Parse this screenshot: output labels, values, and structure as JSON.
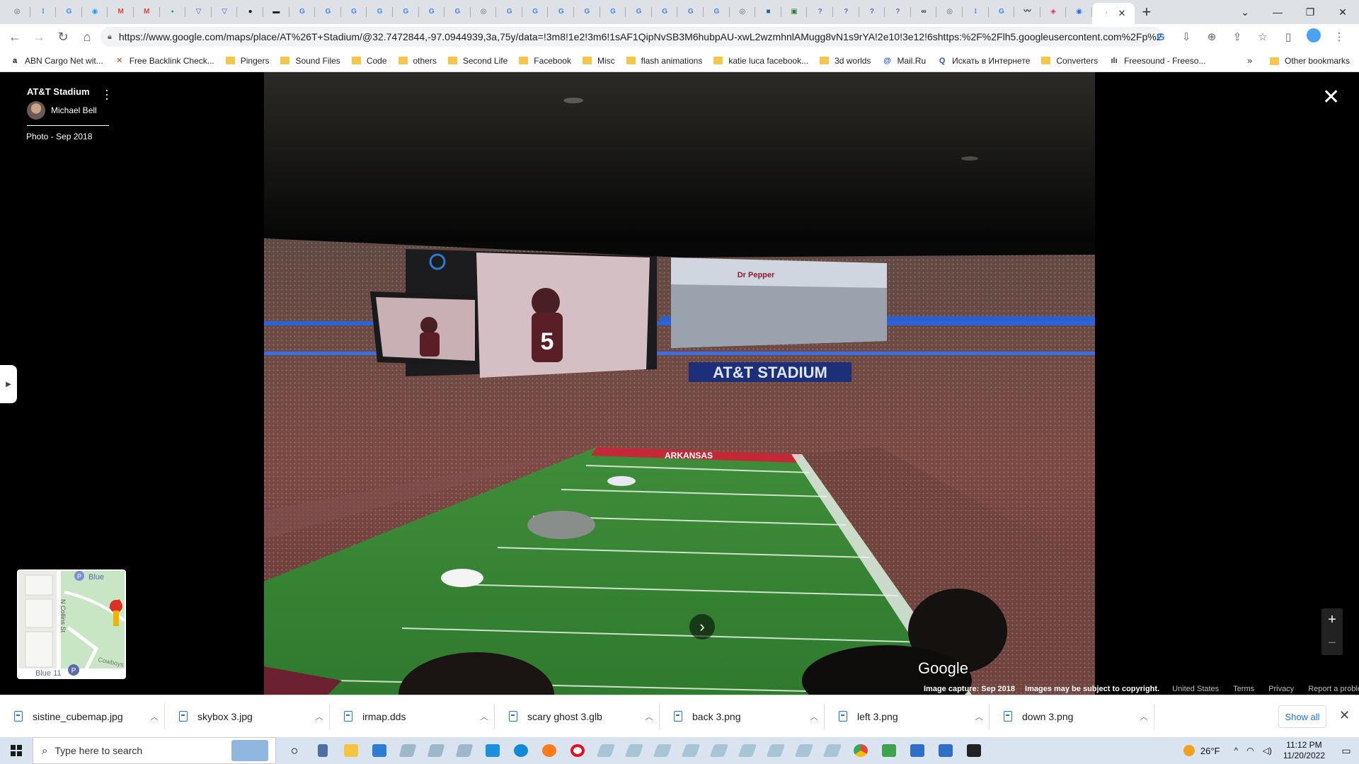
{
  "browser": {
    "tab_icons": [
      {
        "icon": "chrome-icon",
        "color": "#5f6368",
        "glyph": "◎"
      },
      {
        "icon": "translate-icon",
        "color": "#4a8af4",
        "glyph": "⁝"
      },
      {
        "icon": "google-icon",
        "color": "#4285f4",
        "glyph": "G"
      },
      {
        "icon": "photopea-icon",
        "color": "#18a0fb",
        "glyph": "◉"
      },
      {
        "icon": "gmail-icon",
        "color": "#ea4335",
        "glyph": "M"
      },
      {
        "icon": "gmail-icon",
        "color": "#ea4335",
        "glyph": "M"
      },
      {
        "icon": "maps-icon",
        "color": "#34a853",
        "glyph": "⬩"
      },
      {
        "icon": "vpn-icon",
        "color": "#7b3fbf",
        "glyph": "▽"
      },
      {
        "icon": "vpn-icon",
        "color": "#7b3fbf",
        "glyph": "▽"
      },
      {
        "icon": "github-icon",
        "color": "#222222",
        "glyph": "●"
      },
      {
        "icon": "bar-icon",
        "color": "#222222",
        "glyph": "▬"
      },
      {
        "icon": "google-icon",
        "color": "#4285f4",
        "glyph": "G"
      },
      {
        "icon": "google-icon",
        "color": "#4285f4",
        "glyph": "G"
      },
      {
        "icon": "google-icon",
        "color": "#4285f4",
        "glyph": "G"
      },
      {
        "icon": "google-icon",
        "color": "#4285f4",
        "glyph": "G"
      },
      {
        "icon": "google-icon",
        "color": "#4285f4",
        "glyph": "G"
      },
      {
        "icon": "google-icon",
        "color": "#4285f4",
        "glyph": "G"
      },
      {
        "icon": "google-icon",
        "color": "#4285f4",
        "glyph": "G"
      },
      {
        "icon": "chrome-icon",
        "color": "#5f6368",
        "glyph": "◎"
      },
      {
        "icon": "google-icon",
        "color": "#4285f4",
        "glyph": "G"
      },
      {
        "icon": "google-icon",
        "color": "#4285f4",
        "glyph": "G"
      },
      {
        "icon": "google-icon",
        "color": "#4285f4",
        "glyph": "G"
      },
      {
        "icon": "google-icon",
        "color": "#4285f4",
        "glyph": "G"
      },
      {
        "icon": "google-icon",
        "color": "#4285f4",
        "glyph": "G"
      },
      {
        "icon": "google-icon",
        "color": "#4285f4",
        "glyph": "G"
      },
      {
        "icon": "google-icon",
        "color": "#4285f4",
        "glyph": "G"
      },
      {
        "icon": "google-icon",
        "color": "#4285f4",
        "glyph": "G"
      },
      {
        "icon": "google-icon",
        "color": "#4285f4",
        "glyph": "G"
      },
      {
        "icon": "chrome-icon",
        "color": "#5f6368",
        "glyph": "◎"
      },
      {
        "icon": "cube-icon",
        "color": "#1565c0",
        "glyph": "■"
      },
      {
        "icon": "chip-icon",
        "color": "#2e7d32",
        "glyph": "▣"
      },
      {
        "icon": "quora-icon",
        "color": "#7e57c2",
        "glyph": "?"
      },
      {
        "icon": "quora-icon",
        "color": "#7e57c2",
        "glyph": "?"
      },
      {
        "icon": "quora-icon",
        "color": "#7e57c2",
        "glyph": "?"
      },
      {
        "icon": "quora-icon",
        "color": "#7e57c2",
        "glyph": "?"
      },
      {
        "icon": "loop-icon",
        "color": "#222222",
        "glyph": "∞"
      },
      {
        "icon": "chrome-icon",
        "color": "#5f6368",
        "glyph": "◎"
      },
      {
        "icon": "translate-icon",
        "color": "#4a8af4",
        "glyph": "⁝"
      },
      {
        "icon": "google-icon",
        "color": "#4285f4",
        "glyph": "G"
      },
      {
        "icon": "signature-icon",
        "color": "#222222",
        "glyph": "〰"
      },
      {
        "icon": "instagram-icon",
        "color": "#e1306c",
        "glyph": "◈"
      },
      {
        "icon": "edge-icon",
        "color": "#1a73e8",
        "glyph": "◉"
      }
    ],
    "active_tab_close": "✕",
    "new_tab": "+",
    "url": "https://www.google.com/maps/place/AT%26T+Stadium/@32.7472844,-97.0944939,3a,75y/data=!3m8!1e2!3m6!1sAF1QipNvSB3M6hubpAU-xwL2wzmhnlAMugg8vN1s9rYA!2e10!3e12!6shttps:%2F%2Flh5.googleusercontent.com%2Fp%2F...",
    "bookmarks": [
      {
        "label": "ABN Cargo Net wit...",
        "icon": "amazon-icon",
        "type": "site"
      },
      {
        "label": "Free Backlink Check...",
        "icon": "x-icon",
        "type": "site"
      },
      {
        "label": "Pingers",
        "type": "folder"
      },
      {
        "label": "Sound Files",
        "type": "folder"
      },
      {
        "label": "Code",
        "type": "folder"
      },
      {
        "label": "others",
        "type": "folder"
      },
      {
        "label": "Second Life",
        "type": "folder"
      },
      {
        "label": "Facebook",
        "type": "folder"
      },
      {
        "label": "Misc",
        "type": "folder"
      },
      {
        "label": "flash animations",
        "type": "folder"
      },
      {
        "label": "katie luca facebook...",
        "type": "folder"
      },
      {
        "label": "3d worlds",
        "type": "folder"
      },
      {
        "label": "Mail.Ru",
        "icon": "mailru-icon",
        "type": "site"
      },
      {
        "label": "Искать в Интернете",
        "icon": "search-icon",
        "type": "site"
      },
      {
        "label": "Converters",
        "type": "folder"
      },
      {
        "label": "Freesound - Freeso...",
        "icon": "freesound-icon",
        "type": "site"
      }
    ],
    "bookmarks_more": "»",
    "other_bookmarks": "Other bookmarks"
  },
  "viewer": {
    "place_name": "AT&T Stadium",
    "contributor": "Michael Bell",
    "photo_date": "Photo - Sep 2018",
    "photo_caption_board": "AT&T STADIUM",
    "photo_endzone": "ARKANSAS",
    "photo_sponsor": "Dr Pepper",
    "jersey_number": "5",
    "map_labels": {
      "street": "N Collins St",
      "place1": "Blue",
      "place2": "Blue 11",
      "place3": "Cowboys"
    },
    "google_watermark": "Google",
    "zoom_in": "+",
    "zoom_out": "−",
    "footer": {
      "capture": "Image capture: Sep 2018",
      "copyright": "Images may be subject to copyright.",
      "country": "United States",
      "terms": "Terms",
      "privacy": "Privacy",
      "report": "Report a problem"
    }
  },
  "downloads": {
    "items": [
      "sistine_cubemap.jpg",
      "skybox 3.jpg",
      "irmap.dds",
      "scary ghost 3.glb",
      "back 3.png",
      "left 3.png",
      "down 3.png"
    ],
    "show_all": "Show all"
  },
  "taskbar": {
    "search_placeholder": "Type here to search",
    "weather_temp": "26°F",
    "time": "11:12 PM",
    "date": "11/20/2022"
  }
}
